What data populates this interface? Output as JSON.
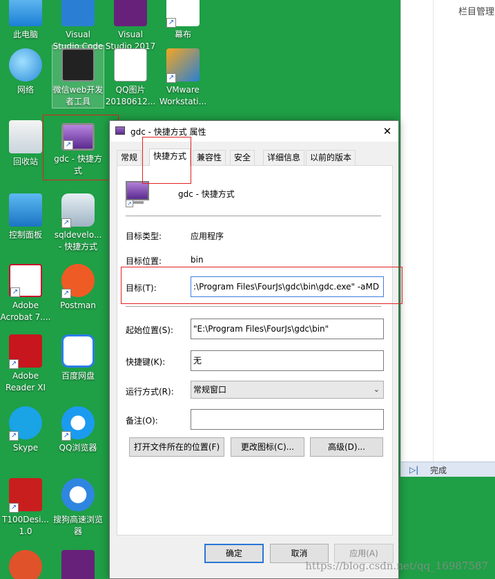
{
  "desktop": {
    "icons": [
      {
        "label": "此电脑",
        "icon": "computer-icon"
      },
      {
        "label": "Visual\nStudio Code",
        "icon": "vscode-icon"
      },
      {
        "label": "Visual\nStudio 2017",
        "icon": "visual-studio-icon"
      },
      {
        "label": "幕布",
        "icon": "mubu-icon"
      },
      {
        "label": "网络",
        "icon": "network-icon"
      },
      {
        "label": "微信web开发\n者工具",
        "icon": "wechat-devtools-icon"
      },
      {
        "label": "QQ图片\n20180612...",
        "icon": "image-file-icon"
      },
      {
        "label": "VMware\nWorkstati...",
        "icon": "vmware-icon"
      },
      {
        "label": "回收站",
        "icon": "recycle-bin-icon"
      },
      {
        "label": "gdc - 快捷方\n式",
        "icon": "monitor-icon"
      },
      {
        "label": "控制面板",
        "icon": "control-panel-icon"
      },
      {
        "label": "sqldevelo...\n- 快捷方式",
        "icon": "database-icon"
      },
      {
        "label": "Adobe\nAcrobat 7....",
        "icon": "acrobat-icon"
      },
      {
        "label": "Postman",
        "icon": "postman-icon"
      },
      {
        "label": "Adobe\nReader XI",
        "icon": "adobe-reader-icon"
      },
      {
        "label": "百度网盘",
        "icon": "baidu-netdisk-icon"
      },
      {
        "label": "Skype",
        "icon": "skype-icon"
      },
      {
        "label": "QQ浏览器",
        "icon": "qq-browser-icon"
      },
      {
        "label": "T100Desi...\n1.0",
        "icon": "t100-icon"
      },
      {
        "label": "搜狗高速浏览\n器",
        "icon": "sogou-browser-icon"
      }
    ]
  },
  "side_window": {
    "title": "栏目管理",
    "status_text": "完成"
  },
  "dialog": {
    "title": "gdc - 快捷方式 属性",
    "tabs": [
      "常规",
      "快捷方式",
      "兼容性",
      "安全",
      "详细信息",
      "以前的版本"
    ],
    "active_tab": "快捷方式",
    "shortcut_name": "gdc - 快捷方式",
    "target_type_label": "目标类型:",
    "target_type_value": "应用程序",
    "target_location_label": "目标位置:",
    "target_location_value": "bin",
    "target_label": "目标(T):",
    "target_value": ":\\Program Files\\FourJs\\gdc\\bin\\gdc.exe\" -aMD",
    "start_in_label": "起始位置(S):",
    "start_in_value": "\"E:\\Program Files\\FourJs\\gdc\\bin\"",
    "shortcut_key_label": "快捷键(K):",
    "shortcut_key_value": "无",
    "run_label": "运行方式(R):",
    "run_value": "常规窗口",
    "comment_label": "备注(O):",
    "comment_value": "",
    "open_location_button": "打开文件所在的位置(F)",
    "change_icon_button": "更改图标(C)...",
    "advanced_button": "高级(D)...",
    "ok_button": "确定",
    "cancel_button": "取消",
    "apply_button": "应用(A)"
  },
  "watermark": "https://blog.csdn.net/qq_16987587",
  "colors": {
    "desktop_bg": "#1f9f46",
    "highlight_red": "#e02020",
    "focus_blue": "#2876d6"
  }
}
